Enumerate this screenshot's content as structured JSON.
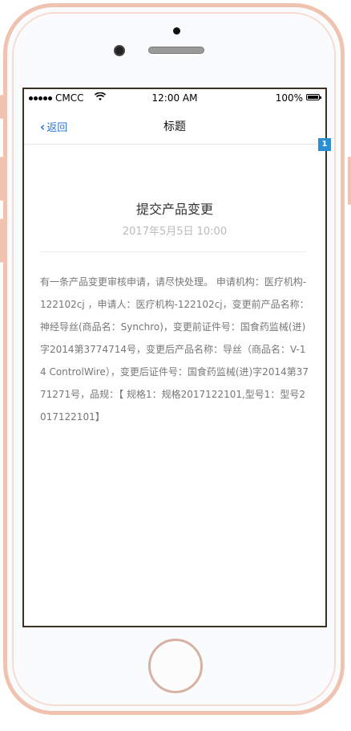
{
  "status_bar": {
    "carrier": "CMCC",
    "time": "12:00 AM",
    "battery": "100%"
  },
  "nav": {
    "back_label": "返回",
    "title": "标题"
  },
  "badge": "1",
  "message": {
    "title": "提交产品变更",
    "date": "2017年5月5日 10:00",
    "body": "有一条产品变更审核申请，请尽快处理。 申请机构：医疗机构-122102cj ，申请人：医疗机构-122102cj，变更前产品名称：神经导丝(商品名：Synchro)，变更前证件号：国食药监械(进)字2014第3774714号，变更后产品名称：导丝（商品名：V-14 ControlWire），变更后证件号：国食药监械(进)字2014第3771271号，品规：【 规格1：规格2017122101,型号1：型号2017122101】"
  },
  "icons": {
    "back": "chevron-left-icon",
    "wifi": "wifi-icon",
    "battery": "battery-icon"
  }
}
